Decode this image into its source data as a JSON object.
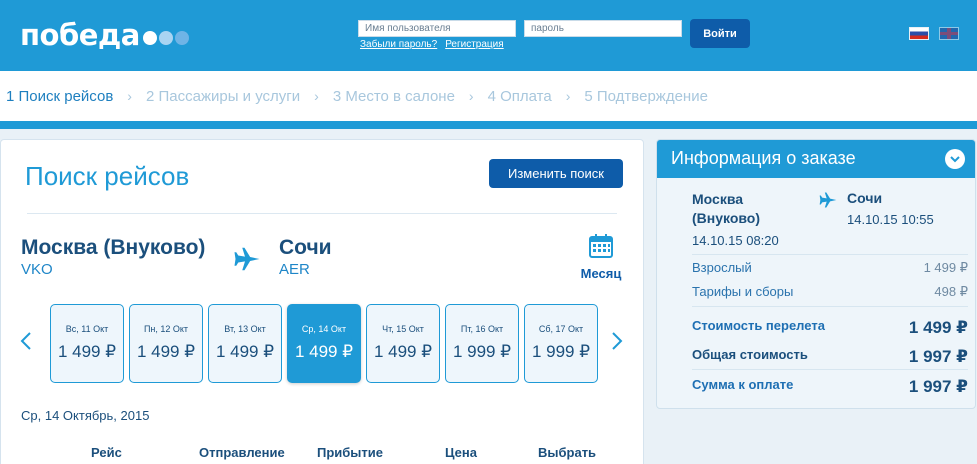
{
  "header": {
    "logo": "победа",
    "username_placeholder": "Имя пользователя",
    "password_placeholder": "пароль",
    "forgot_link": "Забыли пароль?",
    "register_link": "Регистрация",
    "login_button": "Войти",
    "brand_color": "#1f9ad6"
  },
  "steps": [
    {
      "label": "1 Поиск рейсов",
      "active": true
    },
    {
      "label": "2 Пассажиры и услуги",
      "active": false
    },
    {
      "label": "3 Место в салоне",
      "active": false
    },
    {
      "label": "4 Оплата",
      "active": false
    },
    {
      "label": "5 Подтверждение",
      "active": false
    }
  ],
  "steps_separator": "›",
  "search": {
    "title": "Поиск рейсов",
    "change_button": "Изменить поиск",
    "from_city": "Москва (Внуково)",
    "from_code": "VKO",
    "to_city": "Сочи",
    "to_code": "AER",
    "month_label": "Месяц",
    "dates": [
      {
        "label": "Вс, 11 Окт",
        "price": "1 499 ₽",
        "selected": false
      },
      {
        "label": "Пн, 12 Окт",
        "price": "1 499 ₽",
        "selected": false
      },
      {
        "label": "Вт, 13 Окт",
        "price": "1 499 ₽",
        "selected": false
      },
      {
        "label": "Ср, 14 Окт",
        "price": "1 499 ₽",
        "selected": true
      },
      {
        "label": "Чт, 15 Окт",
        "price": "1 499 ₽",
        "selected": false
      },
      {
        "label": "Пт, 16 Окт",
        "price": "1 999 ₽",
        "selected": false
      },
      {
        "label": "Сб, 17 Окт",
        "price": "1 999 ₽",
        "selected": false
      }
    ],
    "selected_date": "Ср, 14 Октябрь, 2015",
    "table_headers": [
      "Рейс",
      "Отправление",
      "Прибытие",
      "Цена",
      "Выбрать"
    ]
  },
  "order": {
    "title": "Информация о заказе",
    "from_line1": "Москва",
    "from_line2": "(Внуково)",
    "to": "Сочи",
    "depart_time": "14.10.15 08:20",
    "arrive_time": "14.10.15 10:55",
    "adult_label": "Взрослый",
    "adult_value": "1 499 ₽",
    "fees_label": "Тарифы и сборы",
    "fees_value": "498 ₽",
    "flight_cost_label": "Стоимость перелета",
    "flight_cost_value": "1 499 ₽",
    "total_label": "Общая стоимость",
    "total_value": "1 997 ₽",
    "pay_label": "Сумма к оплате",
    "pay_value": "1 997 ₽"
  }
}
